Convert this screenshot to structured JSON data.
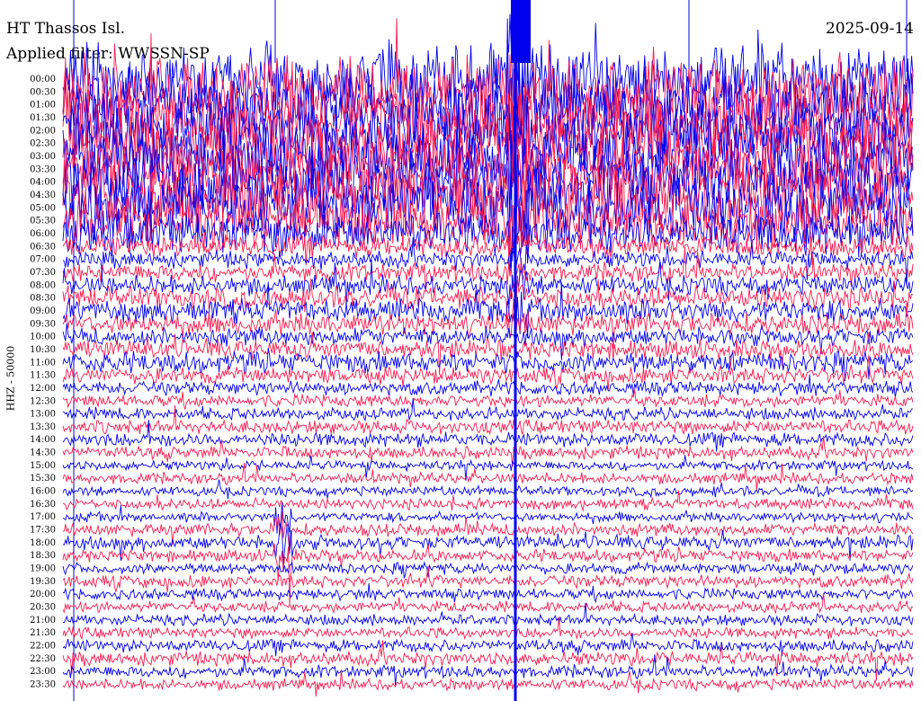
{
  "header": {
    "station": "HT Thassos Isl.",
    "date": "2025-09-14",
    "filter": "Applied filter: WWSSN-SP"
  },
  "axis": {
    "ylabel": "HHZ - 50000"
  },
  "colors": {
    "trace_a": "#0000ee",
    "trace_b": "#ff1a4d",
    "marker": "#0000ee",
    "background": "#ffffff"
  },
  "chart_data": {
    "type": "line",
    "ylabel": "HHZ - 50000",
    "grid": false,
    "legend": "none",
    "time_labels": [
      "00:00",
      "00:30",
      "01:00",
      "01:30",
      "02:00",
      "02:30",
      "03:00",
      "03:30",
      "04:00",
      "04:30",
      "05:00",
      "05:30",
      "06:00",
      "06:30",
      "07:00",
      "07:30",
      "08:00",
      "08:30",
      "09:00",
      "09:30",
      "10:00",
      "10:30",
      "11:00",
      "11:30",
      "12:00",
      "12:30",
      "13:00",
      "13:30",
      "14:00",
      "14:30",
      "15:00",
      "15:30",
      "16:00",
      "16:30",
      "17:00",
      "17:30",
      "18:00",
      "18:30",
      "19:00",
      "19:30",
      "20:00",
      "20:30",
      "21:00",
      "21:30",
      "22:00",
      "22:30",
      "23:00",
      "23:30"
    ],
    "trace_amplitude": [
      5,
      5,
      5,
      5,
      5,
      5,
      5,
      5,
      5,
      5,
      5,
      4,
      3,
      1.6,
      1.2,
      1.3,
      1.4,
      1.6,
      1.7,
      1.5,
      1.3,
      1.4,
      1.5,
      1.2,
      1.0,
      0.9,
      0.9,
      1.0,
      1.0,
      0.9,
      0.7,
      0.8,
      0.7,
      0.8,
      0.7,
      0.9,
      1.0,
      0.9,
      0.8,
      0.9,
      0.8,
      0.8,
      0.8,
      0.8,
      0.9,
      1.0,
      0.9,
      0.8
    ],
    "event_markers_minutes": [
      3,
      9.4,
      18.6,
      24.9,
      29.8
    ]
  }
}
